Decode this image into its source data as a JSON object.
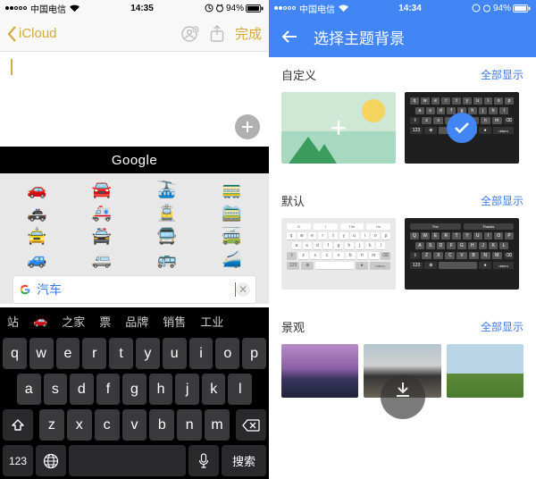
{
  "left": {
    "status": {
      "carrier": "中国电信",
      "time": "14:35",
      "battery": "94%"
    },
    "nav": {
      "back": "iCloud",
      "done": "完成"
    },
    "google_label": "Google",
    "emoji_rows": [
      [
        "🚗",
        "🚘",
        "🚠",
        "🚃"
      ],
      [
        "🚓",
        "🚑",
        "🚊",
        "🚞"
      ],
      [
        "🚖",
        "🚔",
        "🚍",
        "🚎"
      ],
      [
        "🚙",
        "🚐",
        "🚌",
        "🚄"
      ]
    ],
    "search_text": "汽车",
    "suggestions": [
      "站",
      "🚗",
      "之家",
      "票",
      "品牌",
      "销售",
      "工业"
    ],
    "keyboard": {
      "row1": [
        "q",
        "w",
        "e",
        "r",
        "t",
        "y",
        "u",
        "i",
        "o",
        "p"
      ],
      "row2": [
        "a",
        "s",
        "d",
        "f",
        "g",
        "h",
        "j",
        "k",
        "l"
      ],
      "row3": [
        "z",
        "x",
        "c",
        "v",
        "b",
        "n",
        "m"
      ],
      "num": "123",
      "search": "搜索"
    }
  },
  "right": {
    "status": {
      "carrier": "中国电信",
      "time": "14:34",
      "battery": "94%"
    },
    "title": "选择主题背景",
    "show_all": "全部显示",
    "sections": {
      "custom": "自定义",
      "default": "默认",
      "scenic": "景观"
    },
    "mini": {
      "row1": [
        "q",
        "w",
        "e",
        "r",
        "t",
        "y",
        "u",
        "i",
        "o",
        "p"
      ],
      "row2": [
        "a",
        "s",
        "d",
        "f",
        "g",
        "h",
        "j",
        "k",
        "l"
      ],
      "row3": [
        "z",
        "x",
        "c",
        "v",
        "b",
        "n",
        "m"
      ],
      "row1U": [
        "Q",
        "W",
        "E",
        "R",
        "T",
        "Y",
        "U",
        "I",
        "O",
        "P"
      ],
      "row2U": [
        "A",
        "S",
        "D",
        "F",
        "G",
        "H",
        "J",
        "K",
        "L"
      ],
      "row3U": [
        "Z",
        "X",
        "C",
        "V",
        "B",
        "N",
        "M"
      ],
      "num": "123",
      "globe": "⊕",
      "mic": "●",
      "return": "return",
      "sugg_light": [
        "I",
        "The",
        "I'm"
      ],
      "sugg_dark": [
        "The",
        "Thanks"
      ]
    }
  }
}
